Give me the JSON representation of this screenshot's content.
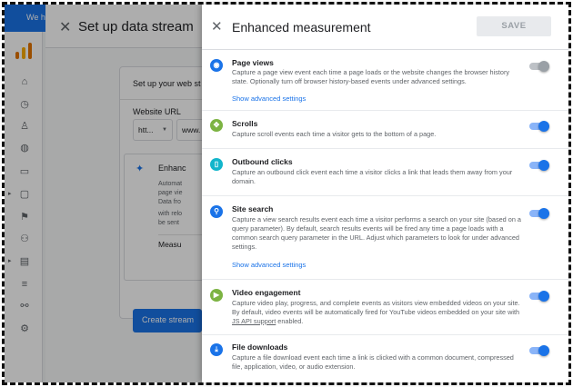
{
  "colors": {
    "accent": "#1a73e8",
    "toggle_on": "#1a73e8",
    "toggle_off": "#9aa0a6"
  },
  "app": {
    "promo_text": "We h",
    "brand_letter": "A"
  },
  "setup_panel": {
    "title": "Set up data stream",
    "card_heading": "Set up your web st",
    "website_url_label": "Website URL",
    "protocol_value": "htt...",
    "url_value": "www.",
    "enhanced_heading": "Enhanc",
    "enhanced_lines": [
      "Automat",
      "page vie",
      "Data fro",
      "with relo",
      "be sent"
    ],
    "measuring_label": "Measu",
    "create_stream_label": "Create stream"
  },
  "panel": {
    "title": "Enhanced measurement",
    "save_label": "SAVE",
    "items": [
      {
        "title": "Page views",
        "icon": "eye-icon",
        "icon_color": "#1a73e8",
        "desc": "Capture a page view event each time a page loads or the website changes the browser history state. Optionally turn off browser history-based events under advanced settings.",
        "link": "Show advanced settings",
        "enabled": false
      },
      {
        "title": "Scrolls",
        "icon": "move-icon",
        "icon_color": "#7cb342",
        "desc": "Capture scroll events each time a visitor gets to the bottom of a page.",
        "enabled": true
      },
      {
        "title": "Outbound clicks",
        "icon": "mouse-icon",
        "icon_color": "#12b5cb",
        "desc": "Capture an outbound click event each time a visitor clicks a link that leads them away from your domain.",
        "enabled": true
      },
      {
        "title": "Site search",
        "icon": "search-icon",
        "icon_color": "#1a73e8",
        "desc": "Capture a view search results event each time a visitor performs a search on your site (based on a query parameter). By default, search results events will be fired any time a page loads with a common search query parameter in the URL. Adjust which parameters to look for under advanced settings.",
        "link": "Show advanced settings",
        "enabled": true
      },
      {
        "title": "Video engagement",
        "icon": "play-icon",
        "icon_color": "#7cb342",
        "desc_before": "Capture video play, progress, and complete events as visitors view embedded videos on your site. By default, video events will be automatically fired for YouTube videos embedded on your site with ",
        "desc_link": "JS API support",
        "desc_after": " enabled.",
        "enabled": true
      },
      {
        "title": "File downloads",
        "icon": "download-icon",
        "icon_color": "#1a73e8",
        "desc": "Capture a file download event each time a link is clicked with a common document, compressed file, application, video, or audio extension.",
        "enabled": true
      }
    ]
  }
}
